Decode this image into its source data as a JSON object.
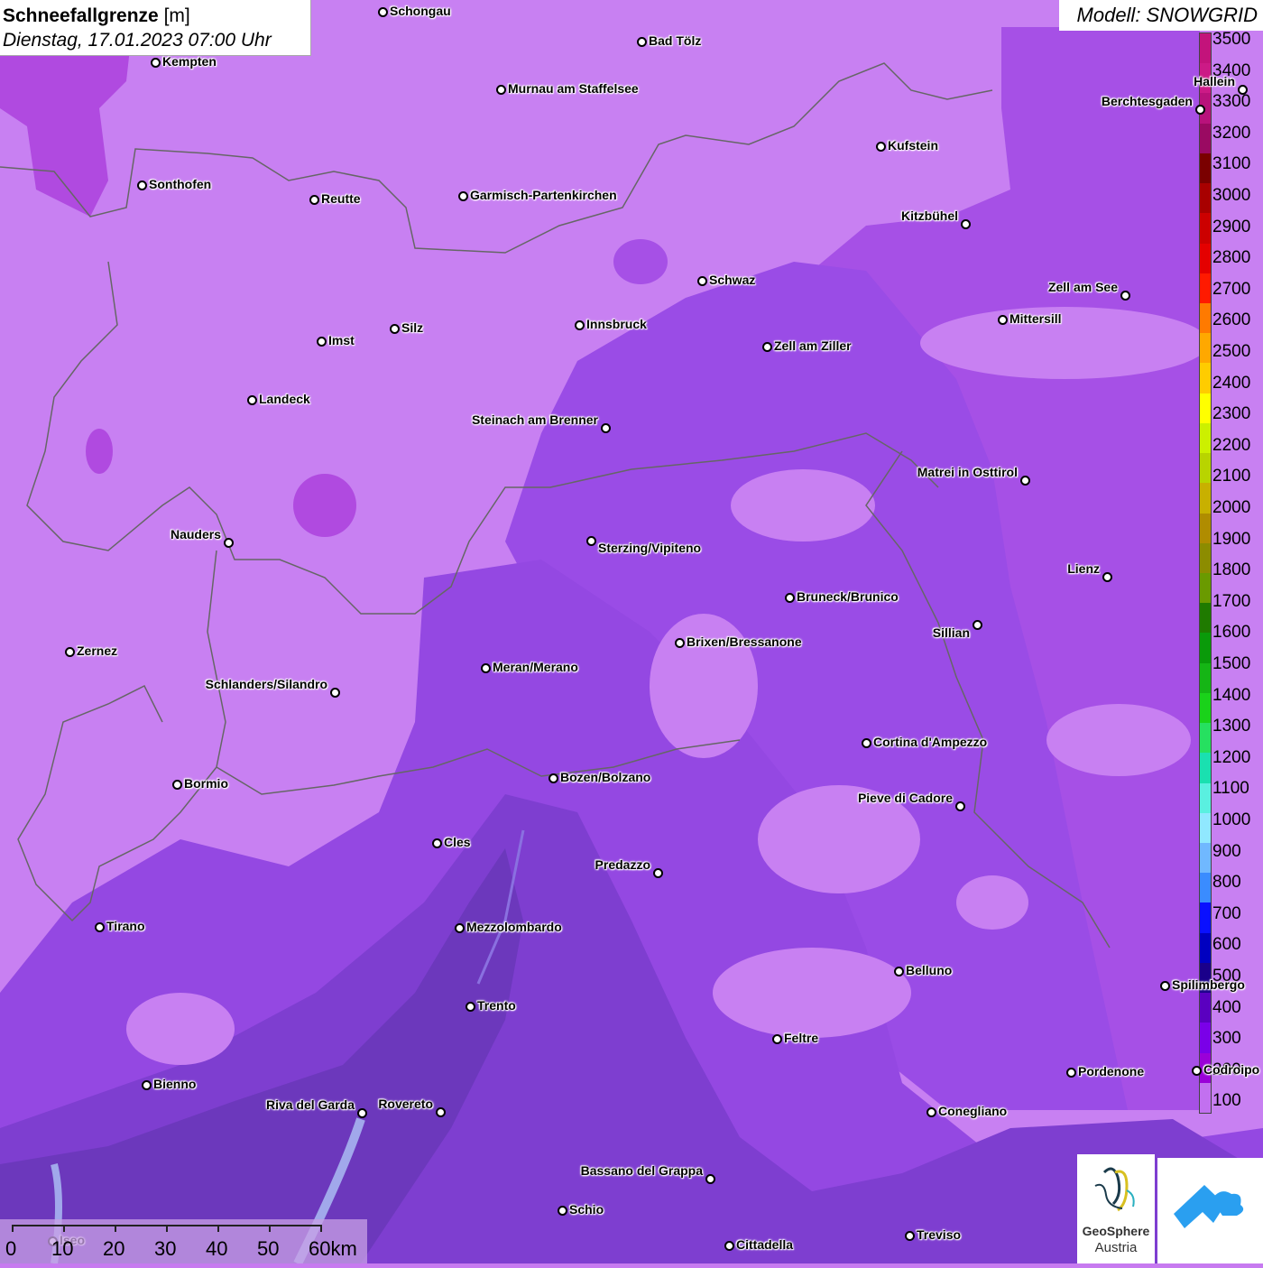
{
  "title": {
    "main": "Schneefallgrenze",
    "unit": "[m]",
    "date": "Dienstag, 17.01.2023 07:00 Uhr"
  },
  "model": "Modell: SNOWGRID",
  "legend": {
    "labels": [
      "3500",
      "3400",
      "3300",
      "3200",
      "3100",
      "3000",
      "2900",
      "2800",
      "2700",
      "2600",
      "2500",
      "2400",
      "2300",
      "2200",
      "2100",
      "2000",
      "1900",
      "1800",
      "1700",
      "1600",
      "1500",
      "1400",
      "1300",
      "1200",
      "1100",
      "1000",
      "900",
      "800",
      "700",
      "600",
      "500",
      "400",
      "300",
      "200",
      "100"
    ],
    "colors": [
      "#c3137b",
      "#cc1a86",
      "#b8127b",
      "#9a0a62",
      "#7a0000",
      "#a80000",
      "#cc0000",
      "#e40000",
      "#ff1a00",
      "#ff7a00",
      "#ffa800",
      "#ffcc00",
      "#ffff00",
      "#ccf000",
      "#b8d400",
      "#c8b000",
      "#b08c00",
      "#8c8c00",
      "#6a9a00",
      "#1f7a00",
      "#0a9a0a",
      "#15b515",
      "#1ad21a",
      "#26e060",
      "#1ae0b0",
      "#5af0e0",
      "#90e8ff",
      "#70b8ff",
      "#3a8cff",
      "#0a10ff",
      "#0000c0",
      "#1a008a",
      "#5a00c0",
      "#7a00e8",
      "#9a00d8",
      "#c270f0"
    ]
  },
  "scale": {
    "labels": [
      "0",
      "10",
      "20",
      "30",
      "40",
      "50",
      "60km"
    ]
  },
  "logo": {
    "line1": "GeoSphere",
    "line2": "Austria"
  },
  "cities": [
    {
      "name": "Schongau"
    },
    {
      "name": "Bad Tölz"
    },
    {
      "name": "Kempten"
    },
    {
      "name": "Murnau am Staffelsee"
    },
    {
      "name": "Hallein"
    },
    {
      "name": "Berchtesgaden"
    },
    {
      "name": "Kufstein"
    },
    {
      "name": "Sonthofen"
    },
    {
      "name": "Reutte"
    },
    {
      "name": "Garmisch-Partenkirchen"
    },
    {
      "name": "Kitzbühel"
    },
    {
      "name": "Schwaz"
    },
    {
      "name": "Zell am See"
    },
    {
      "name": "Mittersill"
    },
    {
      "name": "Innsbruck"
    },
    {
      "name": "Imst"
    },
    {
      "name": "Silz"
    },
    {
      "name": "Zell am Ziller"
    },
    {
      "name": "Landeck"
    },
    {
      "name": "Steinach am Brenner"
    },
    {
      "name": "Matrei in Osttirol"
    },
    {
      "name": "Nauders"
    },
    {
      "name": "Sterzing/Vipiteno"
    },
    {
      "name": "Lienz"
    },
    {
      "name": "Bruneck/Brunico"
    },
    {
      "name": "Sillian"
    },
    {
      "name": "Brixen/Bressanone"
    },
    {
      "name": "Zernez"
    },
    {
      "name": "Meran/Merano"
    },
    {
      "name": "Schlanders/Silandro"
    },
    {
      "name": "Cortina d'Ampezzo"
    },
    {
      "name": "Bormio"
    },
    {
      "name": "Bozen/Bolzano"
    },
    {
      "name": "Pieve di Cadore"
    },
    {
      "name": "Cles"
    },
    {
      "name": "Predazzo"
    },
    {
      "name": "Tirano"
    },
    {
      "name": "Mezzolombardo"
    },
    {
      "name": "Belluno"
    },
    {
      "name": "Spilimbergo"
    },
    {
      "name": "Trento"
    },
    {
      "name": "Feltre"
    },
    {
      "name": "Pordenone"
    },
    {
      "name": "Codroipo"
    },
    {
      "name": "Bienno"
    },
    {
      "name": "Riva del Garda"
    },
    {
      "name": "Rovereto"
    },
    {
      "name": "Conegliano"
    },
    {
      "name": "Bassano del Grappa"
    },
    {
      "name": "Schio"
    },
    {
      "name": "Treviso"
    },
    {
      "name": "Cittadella"
    },
    {
      "name": "Iseo"
    }
  ]
}
